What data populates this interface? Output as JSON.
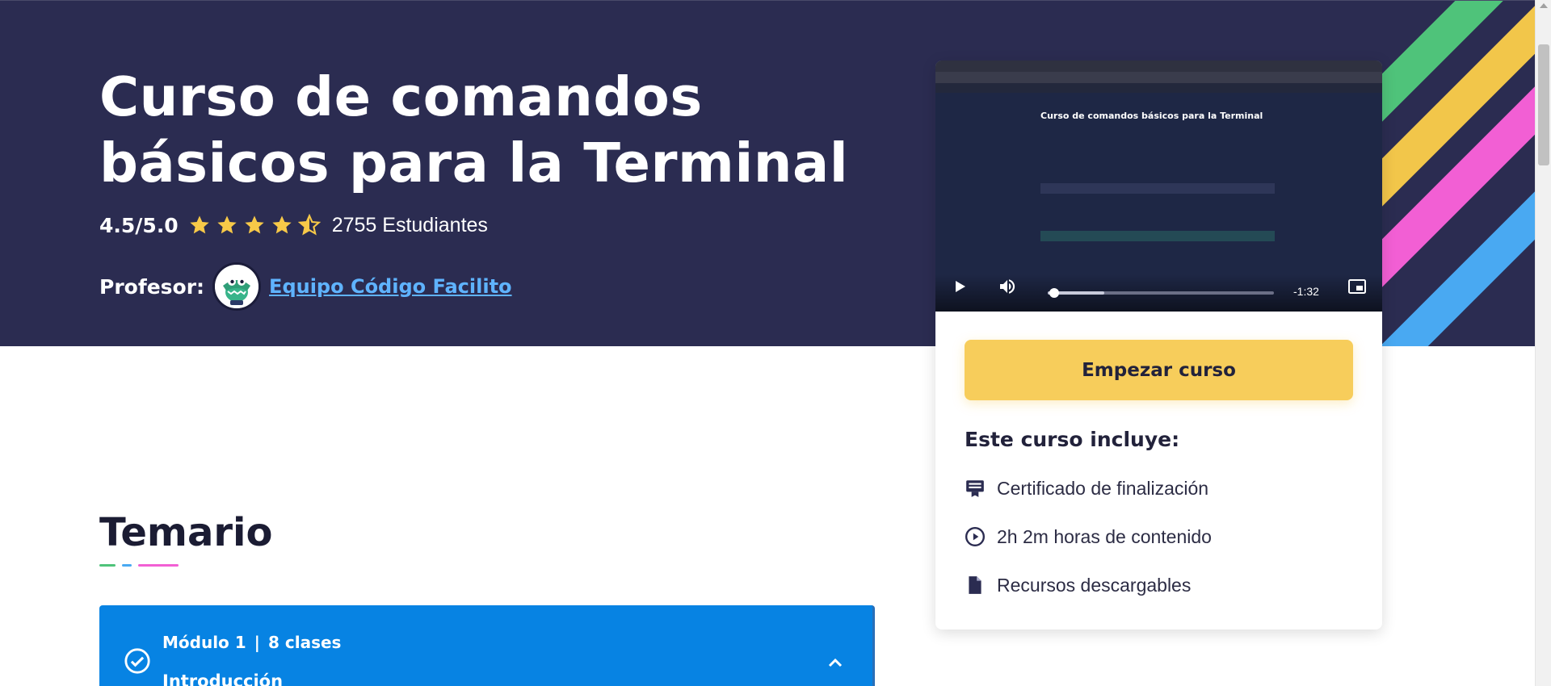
{
  "hero": {
    "title": "Curso de comandos básicos para la Terminal",
    "rating": "4.5/5.0",
    "stars": 4.5,
    "students": "2755 Estudiantes",
    "professor_label": "Profesor:",
    "professor_name": "Equipo Código Facilito"
  },
  "video": {
    "inner_title": "Curso de comandos básicos para la Terminal",
    "time_remaining": "-1:32",
    "progress": 0.03,
    "buffered": 0.25
  },
  "card": {
    "start_button": "Empezar curso",
    "includes_title": "Este curso incluye:",
    "includes": [
      {
        "icon": "certificate-icon",
        "label": "Certificado de finalización"
      },
      {
        "icon": "play-circle-icon",
        "label": "2h 2m  horas de contenido"
      },
      {
        "icon": "file-icon",
        "label": "Recursos descargables"
      }
    ]
  },
  "syllabus": {
    "title": "Temario",
    "module": {
      "number": "Módulo 1",
      "classes": "8 clases",
      "name": "Introducción"
    }
  },
  "colors": {
    "hero_bg": "#2b2c51",
    "accent_yellow": "#f7cd5b",
    "link_blue": "#5fb3ff",
    "module_blue": "#0783e3",
    "stripe_green": "#4fc37a",
    "stripe_yellow": "#f2c64a",
    "stripe_pink": "#f25fd4",
    "stripe_blue": "#49a9f2"
  }
}
